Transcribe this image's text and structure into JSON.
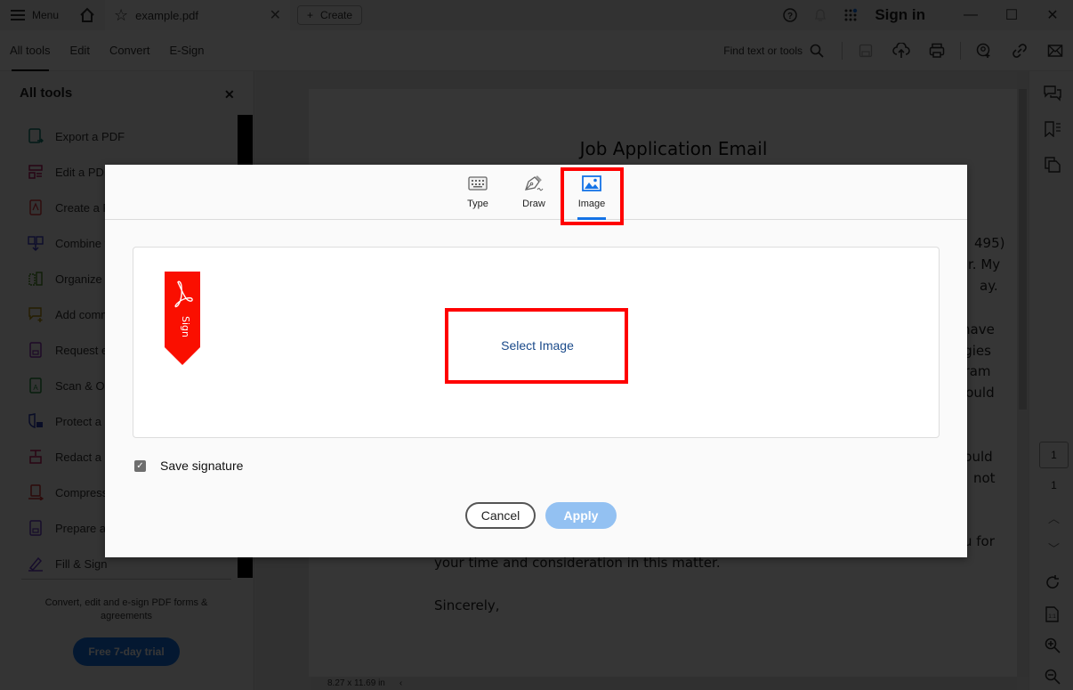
{
  "titlebar": {
    "menu_label": "Menu",
    "tab_name": "example.pdf",
    "create_label": "Create",
    "sign_in_label": "Sign in"
  },
  "toolbar": {
    "tabs": [
      {
        "label": "All tools",
        "active": true
      },
      {
        "label": "Edit"
      },
      {
        "label": "Convert"
      },
      {
        "label": "E-Sign"
      }
    ],
    "find_label": "Find text or tools"
  },
  "sidebar": {
    "title": "All tools",
    "items": [
      {
        "label": "Export a PDF",
        "icon": "export-pdf-icon",
        "color": "#0d7a6e"
      },
      {
        "label": "Edit a PDF",
        "icon": "edit-pdf-icon",
        "color": "#b3135c"
      },
      {
        "label": "Create a PDF",
        "icon": "create-pdf-icon",
        "color": "#d7373f"
      },
      {
        "label": "Combine files",
        "icon": "combine-files-icon",
        "color": "#3d3dc9"
      },
      {
        "label": "Organize pages",
        "icon": "organize-pages-icon",
        "color": "#4a8f1e"
      },
      {
        "label": "Add comments",
        "icon": "add-comments-icon",
        "color": "#b08a00"
      },
      {
        "label": "Request e-signatures",
        "icon": "request-esign-icon",
        "color": "#8a2bb3"
      },
      {
        "label": "Scan & OCR",
        "icon": "scan-ocr-icon",
        "color": "#1e8a3a"
      },
      {
        "label": "Protect a PDF",
        "icon": "protect-pdf-icon",
        "color": "#2b3fb3"
      },
      {
        "label": "Redact a PDF",
        "icon": "redact-pdf-icon",
        "color": "#c2185b"
      },
      {
        "label": "Compress a PDF",
        "icon": "compress-pdf-icon",
        "color": "#d32f2f"
      },
      {
        "label": "Prepare a form",
        "icon": "prepare-form-icon",
        "color": "#6a3dc9"
      },
      {
        "label": "Fill & Sign",
        "icon": "fill-sign-icon",
        "color": "#6a3dc9"
      }
    ],
    "promo_text": "Convert, edit and e-sign PDF forms & agreements",
    "trial_label": "Free 7-day trial"
  },
  "document": {
    "title": "Job Application Email",
    "fragments": [
      "495)",
      "r. My",
      "ay.",
      "have",
      "egies",
      "gram",
      "could",
      "would",
      "not",
      "u for"
    ],
    "closing_line": "your time and consideration in this matter.",
    "signoff": "Sincerely,",
    "page_size": "8.27 x 11.69 in"
  },
  "rail": {
    "current_page": "1",
    "total_pages": "1"
  },
  "modal": {
    "tabs": [
      {
        "label": "Type",
        "icon": "keyboard-icon"
      },
      {
        "label": "Draw",
        "icon": "pen-nib-icon"
      },
      {
        "label": "Image",
        "icon": "image-icon",
        "active": true
      }
    ],
    "badge_text": "Sign",
    "select_image_label": "Select Image",
    "save_signature_label": "Save signature",
    "save_signature_checked": true,
    "cancel_label": "Cancel",
    "apply_label": "Apply",
    "colors": {
      "accent": "#1473e6",
      "apply_disabled": "#93c1f2",
      "highlight": "#ff0000",
      "badge": "#fa0f00"
    }
  }
}
